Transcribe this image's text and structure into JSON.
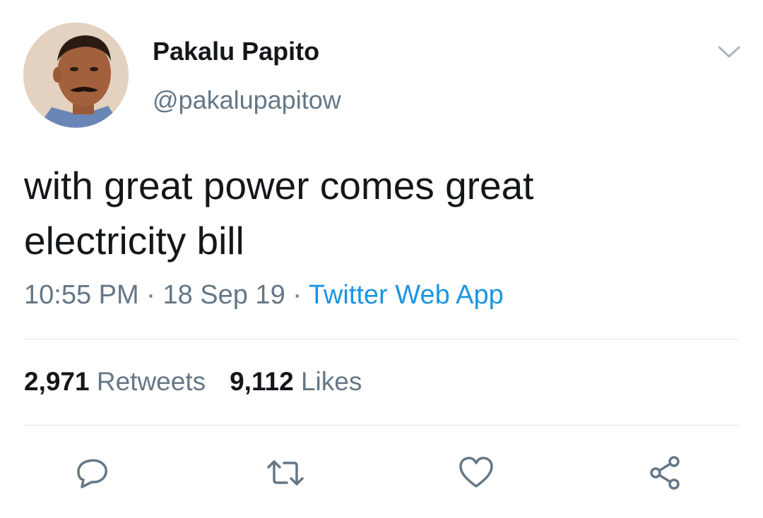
{
  "user": {
    "display_name": "Pakalu Papito",
    "handle": "@pakalupapitow"
  },
  "tweet": {
    "text": "with great power comes great electricity bill",
    "time": "10:55 PM",
    "date": "18 Sep 19",
    "separator": " · ",
    "source": "Twitter Web App"
  },
  "stats": {
    "retweets_count": "2,971",
    "retweets_label": "Retweets",
    "likes_count": "9,112",
    "likes_label": "Likes"
  },
  "actions": {
    "icons": [
      "reply-icon",
      "retweet-icon",
      "like-icon",
      "share-icon"
    ]
  },
  "colors": {
    "text": "#14171a",
    "secondary": "#657786",
    "link": "#1b95e0",
    "divider": "#e1e8ed"
  }
}
